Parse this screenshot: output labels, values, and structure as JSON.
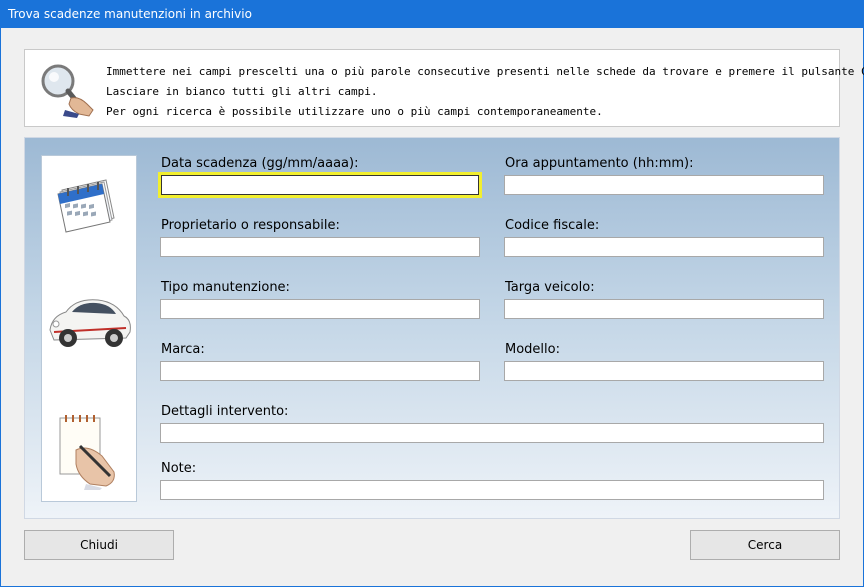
{
  "window": {
    "title": "Trova scadenze manutenzioni in archivio"
  },
  "info": {
    "lines": [
      "Immettere nei campi prescelti una o più parole consecutive presenti nelle schede da trovare e premere il pulsante Cerca.",
      "Lasciare in bianco tutti gli altri campi.",
      "Per ogni ricerca è possibile utilizzare uno o più campi contemporaneamente."
    ]
  },
  "form": {
    "data_scadenza": {
      "label": "Data scadenza (gg/mm/aaaa):",
      "value": ""
    },
    "ora_appuntamento": {
      "label": "Ora appuntamento (hh:mm):",
      "value": ""
    },
    "proprietario": {
      "label": "Proprietario o responsabile:",
      "value": ""
    },
    "codice_fiscale": {
      "label": "Codice fiscale:",
      "value": ""
    },
    "tipo_manutenzione": {
      "label": "Tipo manutenzione:",
      "value": ""
    },
    "targa_veicolo": {
      "label": "Targa veicolo:",
      "value": ""
    },
    "marca": {
      "label": "Marca:",
      "value": ""
    },
    "modello": {
      "label": "Modello:",
      "value": ""
    },
    "dettagli_intervento": {
      "label": "Dettagli intervento:",
      "value": ""
    },
    "note": {
      "label": "Note:",
      "value": ""
    }
  },
  "buttons": {
    "close": "Chiudi",
    "search": "Cerca"
  },
  "icons": [
    "magnifier-icon",
    "calendar-icon",
    "car-icon",
    "notepad-icon"
  ],
  "colors": {
    "titlebar": "#1a73d9",
    "focus_border": "#f2ef2e"
  }
}
